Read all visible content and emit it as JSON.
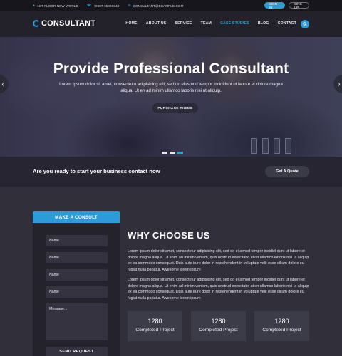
{
  "topbar": {
    "address": "1ST FLOOR NEW WORLD",
    "phone": "+9907 35808343",
    "email": "CONSULTANT@EXAMPLE.COM",
    "sign_in": "SIGN IN",
    "sign_up": "SING UP"
  },
  "nav": {
    "logo": "CONSULTANT",
    "items": [
      "HOME",
      "ABOUT US",
      "SERVICE",
      "TEAM",
      "CASE STUDIES",
      "BLOG",
      "CONTACT"
    ],
    "active": "CASE STUDIES"
  },
  "hero": {
    "title": "Provide Professional Consultant",
    "text": "Lorem ipsum dolor sit amet, consectetur adipisicing elit, sed do eiusmod tempor incididunt ut labore et dolore magna aliqua. Ut en ad minim ullamco laboris nisi ut aliquip.",
    "button": "PURCHASE THEME"
  },
  "band": {
    "text": "Are you ready to start your business contact now",
    "button": "Get A Quote"
  },
  "consult": {
    "title": "MAKE A CONSULT",
    "fields": [
      "Name",
      "Name",
      "Name",
      "Name"
    ],
    "message_placeholder": "Message...",
    "submit": "SEND REQUEST"
  },
  "why": {
    "title": "WHY CHOOSE US",
    "paragraph1": "Lorem ipsum dolor sit amet, consectetur adipisicing elit, sed do eiusmod tempor incidiel dunt ut labore et dolore magna aliqua. Ut enim ad minim veniam, quis nostrud exercitatio ation ullamco laboris nisi ut aliquip ex ea commodo consequat. Duis aute irure dolor in reprehenderit in voluptate velit esse cillum dolore eu fugiat nulla pariatur. Awesome lorem ipsum",
    "paragraph2": "Lorem ipsum dolor sit amet, consectetur adipisicing elit, sed do eiusmod tempor incidiel dunt ut labore et dolore magna aliqua. Ut enim ad minim veniam, quis nostrud exercitatio ation ullamco laboris nisi ut aliquip ex ea commodo consequat. Duis aute irure dolor in reprehenderit in voluptate velit esse cillum dolore eu fugiat nulla pariatur. Awesome lorem ipsum",
    "stats": [
      {
        "number": "1280",
        "label": "Completed Project"
      },
      {
        "number": "1280",
        "label": "Completed Project"
      },
      {
        "number": "1280",
        "label": "Completed Project"
      }
    ]
  },
  "colors": {
    "accent": "#2d9bd7",
    "background": "#302f3a",
    "topbar": "#17161d",
    "navbar": "#23222b"
  }
}
